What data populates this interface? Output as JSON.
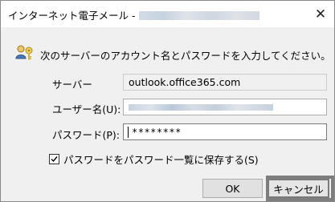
{
  "dialog": {
    "title": "インターネット電子メール -",
    "close_glyph": "✕",
    "prompt": "次のサーバーのアカウント名とパスワードを入力してください。"
  },
  "form": {
    "server_label": "サーバー",
    "server_value": "outlook.office365.com",
    "username_label": "ユーザー名(U):",
    "password_label": "パスワード(P):",
    "password_value": "********",
    "save_password_label": "パスワードをパスワード一覧に保存する(S)",
    "save_password_checked": true
  },
  "buttons": {
    "ok": "OK",
    "cancel": "キャンセル"
  },
  "icons": {
    "credential": "key-person-icon",
    "close": "close-icon",
    "checkmark": "checkmark-icon"
  }
}
